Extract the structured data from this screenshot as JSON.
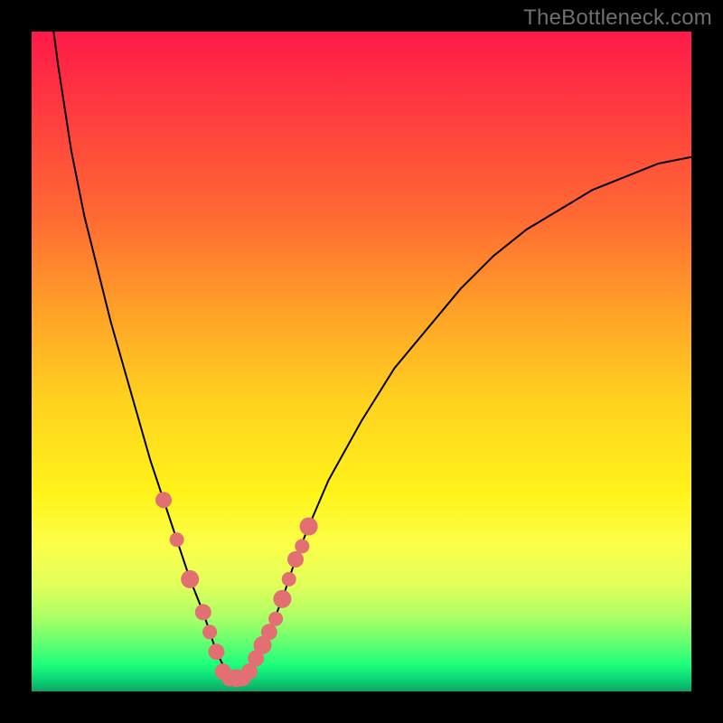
{
  "watermark": "TheBottleneck.com",
  "colors": {
    "background": "#000000",
    "gradient_top": "#ff1a49",
    "gradient_bottom": "#0aa763",
    "curve": "#000000",
    "marker": "#e26f72"
  },
  "chart_data": {
    "type": "line",
    "title": "",
    "xlabel": "",
    "ylabel": "",
    "xlim": [
      0,
      100
    ],
    "ylim": [
      0,
      100
    ],
    "x": [
      0,
      2,
      4,
      6,
      8,
      10,
      12,
      14,
      16,
      18,
      20,
      22,
      24,
      26,
      27,
      28,
      29,
      30,
      31,
      32,
      33,
      34,
      35,
      36,
      38,
      40,
      42,
      45,
      50,
      55,
      60,
      65,
      70,
      75,
      80,
      85,
      90,
      95,
      100
    ],
    "y": [
      128,
      110,
      95,
      82,
      72,
      64,
      56,
      49,
      42,
      35,
      29,
      23,
      17,
      12,
      9,
      6,
      4,
      3,
      2,
      2,
      3,
      4,
      6,
      9,
      14,
      20,
      25,
      32,
      41,
      49,
      55,
      61,
      66,
      70,
      73,
      76,
      78,
      80,
      81
    ],
    "markers_left": {
      "x": [
        20,
        22,
        24,
        26,
        27,
        28
      ],
      "y": [
        29,
        23,
        17,
        12,
        9,
        6
      ],
      "radius": [
        9,
        8,
        10,
        9,
        8,
        9
      ]
    },
    "markers_right": {
      "x": [
        34,
        35,
        36,
        37,
        38,
        39,
        40,
        41,
        42
      ],
      "y": [
        5,
        7,
        9,
        11,
        14,
        17,
        20,
        22,
        25
      ],
      "radius": [
        9,
        10,
        9,
        8,
        10,
        8,
        9,
        8,
        10
      ]
    },
    "markers_bottom": {
      "x": [
        29,
        30,
        31,
        32,
        33
      ],
      "y": [
        3,
        2,
        2,
        2,
        3
      ],
      "radius": [
        9,
        9,
        10,
        9,
        9
      ]
    },
    "grid": false,
    "legend": false
  }
}
